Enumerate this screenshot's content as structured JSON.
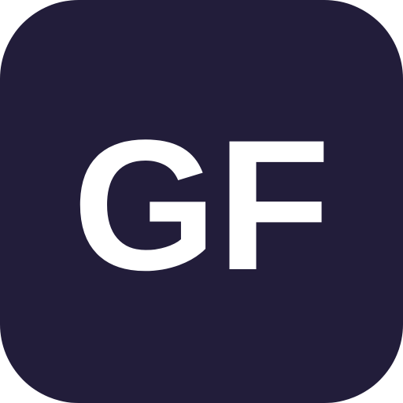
{
  "icon": {
    "name": "app-icon",
    "monogram": "GF",
    "background_color": "#221d3a",
    "text_color": "#ffffff"
  }
}
